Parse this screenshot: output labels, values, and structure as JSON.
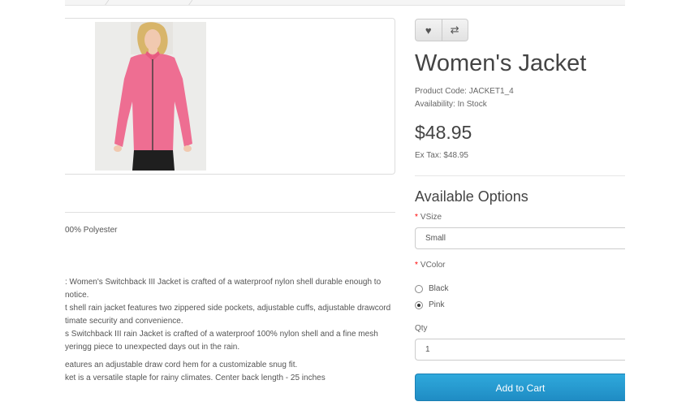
{
  "product": {
    "name": "Women's Jacket",
    "code_line": "Product Code: JACKET1_4",
    "availability_line": "Availability: In Stock",
    "price": "$48.95",
    "extax_line": "Ex Tax: $48.95"
  },
  "actions": {
    "wishlist_icon": "heart-icon",
    "compare_icon": "compare-arrows-icon"
  },
  "options": {
    "title": "Available Options",
    "size": {
      "label": "VSize",
      "value": "Small"
    },
    "color": {
      "label": "VColor",
      "choices": [
        {
          "label": "Black",
          "checked": false
        },
        {
          "label": "Pink",
          "checked": true
        }
      ]
    },
    "qty": {
      "label": "Qty",
      "value": "1"
    },
    "required_mark": "*"
  },
  "cart": {
    "label": "Add to Cart",
    "color": "#229ac8"
  },
  "description": {
    "material": "00% Polyester",
    "paragraph1": [
      ": Women's Switchback III Jacket is crafted of a waterproof nylon shell durable enough to",
      "notice.",
      "t shell rain jacket features two zippered side pockets, adjustable cuffs, adjustable drawcord",
      "timate security and convenience.",
      "s Switchback III rain Jacket is crafted of a waterproof 100% nylon shell and a fine mesh",
      "yeringg piece to unexpected days out in the rain."
    ],
    "paragraph2": [
      "eatures an adjustable draw cord hem for a customizable snug fit.",
      "ket is a versatile staple for rainy climates. Center back length - 25 inches"
    ]
  }
}
